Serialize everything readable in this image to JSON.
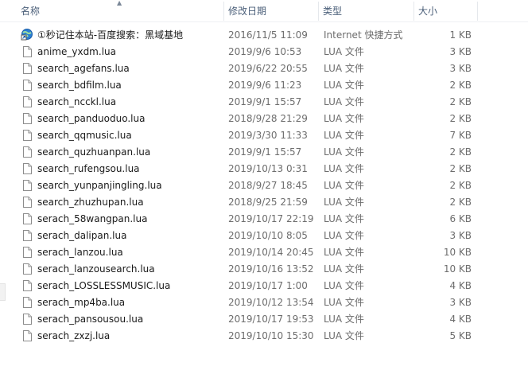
{
  "header": {
    "name": "名称",
    "date": "修改日期",
    "type": "类型",
    "size": "大小"
  },
  "files": [
    {
      "name": "①秒记住本站-百度搜索：黑域基地",
      "date": "2016/11/5 11:09",
      "type": "Internet 快捷方式",
      "size": "1 KB",
      "icon": "internet-shortcut-icon"
    },
    {
      "name": "anime_yxdm.lua",
      "date": "2019/9/6 10:53",
      "type": "LUA 文件",
      "size": "3 KB",
      "icon": "file-icon"
    },
    {
      "name": "search_agefans.lua",
      "date": "2019/6/22 20:55",
      "type": "LUA 文件",
      "size": "3 KB",
      "icon": "file-icon"
    },
    {
      "name": "search_bdfilm.lua",
      "date": "2019/9/6 11:23",
      "type": "LUA 文件",
      "size": "2 KB",
      "icon": "file-icon"
    },
    {
      "name": "search_ncckl.lua",
      "date": "2019/9/1 15:57",
      "type": "LUA 文件",
      "size": "2 KB",
      "icon": "file-icon"
    },
    {
      "name": "search_panduoduo.lua",
      "date": "2018/9/28 21:29",
      "type": "LUA 文件",
      "size": "2 KB",
      "icon": "file-icon"
    },
    {
      "name": "search_qqmusic.lua",
      "date": "2019/3/30 11:33",
      "type": "LUA 文件",
      "size": "7 KB",
      "icon": "file-icon"
    },
    {
      "name": "search_quzhuanpan.lua",
      "date": "2019/9/1 15:57",
      "type": "LUA 文件",
      "size": "2 KB",
      "icon": "file-icon"
    },
    {
      "name": "search_rufengsou.lua",
      "date": "2019/10/13 0:31",
      "type": "LUA 文件",
      "size": "2 KB",
      "icon": "file-icon"
    },
    {
      "name": "search_yunpanjingling.lua",
      "date": "2018/9/27 18:45",
      "type": "LUA 文件",
      "size": "2 KB",
      "icon": "file-icon"
    },
    {
      "name": "search_zhuzhupan.lua",
      "date": "2018/9/25 21:59",
      "type": "LUA 文件",
      "size": "2 KB",
      "icon": "file-icon"
    },
    {
      "name": "serach_58wangpan.lua",
      "date": "2019/10/17 22:19",
      "type": "LUA 文件",
      "size": "6 KB",
      "icon": "file-icon"
    },
    {
      "name": "serach_dalipan.lua",
      "date": "2019/10/10 8:05",
      "type": "LUA 文件",
      "size": "3 KB",
      "icon": "file-icon"
    },
    {
      "name": "serach_lanzou.lua",
      "date": "2019/10/14 20:45",
      "type": "LUA 文件",
      "size": "10 KB",
      "icon": "file-icon"
    },
    {
      "name": "serach_lanzousearch.lua",
      "date": "2019/10/16 13:52",
      "type": "LUA 文件",
      "size": "10 KB",
      "icon": "file-icon"
    },
    {
      "name": "serach_LOSSLESSMUSIC.lua",
      "date": "2019/10/17 1:00",
      "type": "LUA 文件",
      "size": "4 KB",
      "icon": "file-icon"
    },
    {
      "name": "serach_mp4ba.lua",
      "date": "2019/10/12 13:54",
      "type": "LUA 文件",
      "size": "3 KB",
      "icon": "file-icon"
    },
    {
      "name": "serach_pansousou.lua",
      "date": "2019/10/17 19:53",
      "type": "LUA 文件",
      "size": "4 KB",
      "icon": "file-icon"
    },
    {
      "name": "serach_zxzj.lua",
      "date": "2019/10/10 15:30",
      "type": "LUA 文件",
      "size": "5 KB",
      "icon": "file-icon"
    }
  ]
}
